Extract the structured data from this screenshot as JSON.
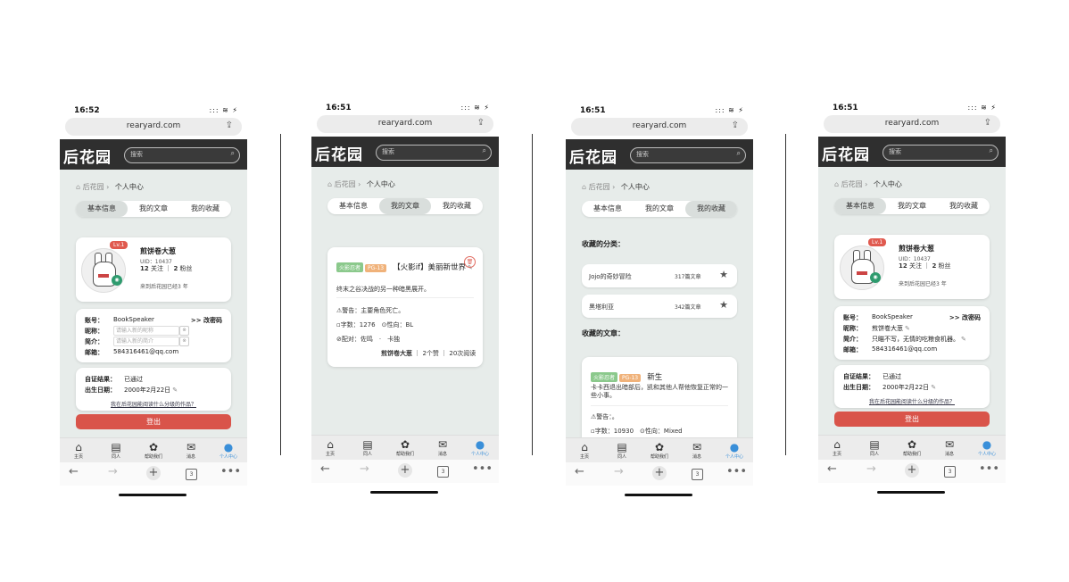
{
  "status": {
    "time1": "16:52",
    "time2": "16:51",
    "time3": "16:51",
    "time4": "16:51",
    "icons": "::: ≋ ⚡"
  },
  "browser": {
    "url": "rearyard.com",
    "share_icon": "share-icon"
  },
  "site": {
    "logo": "后花园",
    "search_placeholder": "搜索"
  },
  "breadcrumb": {
    "home": "后花园",
    "current": "个人中心"
  },
  "tabs": [
    "基本信息",
    "我的文章",
    "我的收藏"
  ],
  "profile": {
    "level": "Lv.1",
    "name": "煎饼卷大葱",
    "uid": "UID：10437",
    "following_count": "12",
    "following_label": "关注",
    "fans_count": "2",
    "fans_label": "粉丝",
    "since": "来到后花园已经3 年"
  },
  "account": {
    "account_label": "账号：",
    "account_value": "BookSpeaker",
    "change_pwd": ">> 改密码",
    "nickname_label": "昵称：",
    "nickname_placeholder": "请输入新的昵称",
    "nickname_value": "煎饼卷大葱",
    "bio_label": "简介：",
    "bio_placeholder": "请输入新的简介",
    "bio_value": "只瞄不写，无情的吃粮食机器。",
    "email_label": "邮箱：",
    "email_value": "584316461@qq.com"
  },
  "verify": {
    "result_label": "自证结果：",
    "result_value": "已通过",
    "birth_label": "出生日期：",
    "birth_value": "2000年2月22日",
    "link": "我在后花园能阅读什么分级的作品？"
  },
  "logout": "登出",
  "article": {
    "tag1": "火影忍者",
    "tag2": "PG-13",
    "title": "【火影if】美丽新世界",
    "summary": "终末之谷决战的另一种暗黑展开。",
    "warning": "警告：主要角色死亡。",
    "words": "字数：1276",
    "orientation": "性向：BL",
    "pairing": "配对：佐鸣　·　卡独",
    "author": "煎饼卷大葱",
    "likes": "2个赞",
    "reads": "20次阅读"
  },
  "favorites": {
    "cat_title": "收藏的分类：",
    "categories": [
      {
        "name": "Jojo的奇妙冒险",
        "count": "317篇文章"
      },
      {
        "name": "黑塔利亚",
        "count": "342篇文章"
      }
    ],
    "articles_title": "收藏的文章：",
    "fav_article": {
      "tag1": "火影忍者",
      "tag2": "PG-13",
      "title": "新生",
      "summary": "卡卡西退出暗部后，凯和其他人帮他恢复正常的一些小事。",
      "warning": "警告：。",
      "words": "字数：10930",
      "orientation": "性向：Mixed"
    }
  },
  "tabbar": [
    "主页",
    "同人",
    "帮助我们",
    "消息",
    "个人中心"
  ]
}
